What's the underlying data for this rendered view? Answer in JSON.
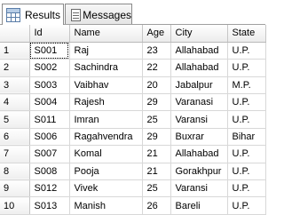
{
  "tabs": [
    {
      "label": "Results",
      "icon": "grid-icon",
      "active": true
    },
    {
      "label": "Messages",
      "icon": "messages-icon",
      "active": false
    }
  ],
  "columns": [
    "",
    "Id",
    "Name",
    "Age",
    "City",
    "State"
  ],
  "rows": [
    {
      "num": "1",
      "id": "S001",
      "name": "Raj",
      "age": "23",
      "city": "Allahabad",
      "state": "U.P."
    },
    {
      "num": "2",
      "id": "S002",
      "name": "Sachindra",
      "age": "22",
      "city": "Allahabad",
      "state": "U.P."
    },
    {
      "num": "3",
      "id": "S003",
      "name": "Vaibhav",
      "age": "20",
      "city": "Jabalpur",
      "state": "M.P."
    },
    {
      "num": "4",
      "id": "S004",
      "name": "Rajesh",
      "age": "29",
      "city": "Varanasi",
      "state": "U.P."
    },
    {
      "num": "5",
      "id": "S011",
      "name": "Imran",
      "age": "25",
      "city": "Varansi",
      "state": "U.P."
    },
    {
      "num": "6",
      "id": "S006",
      "name": "Ragahvendra",
      "age": "29",
      "city": "Buxrar",
      "state": "Bihar"
    },
    {
      "num": "7",
      "id": "S007",
      "name": "Komal",
      "age": "21",
      "city": "Allahabad",
      "state": "U.P."
    },
    {
      "num": "8",
      "id": "S008",
      "name": "Pooja",
      "age": "21",
      "city": "Gorakhpur",
      "state": "U.P."
    },
    {
      "num": "9",
      "id": "S012",
      "name": "Vivek",
      "age": "25",
      "city": "Varansi",
      "state": "U.P."
    },
    {
      "num": "10",
      "id": "S013",
      "name": "Manish",
      "age": "26",
      "city": "Bareli",
      "state": "U.P."
    }
  ]
}
